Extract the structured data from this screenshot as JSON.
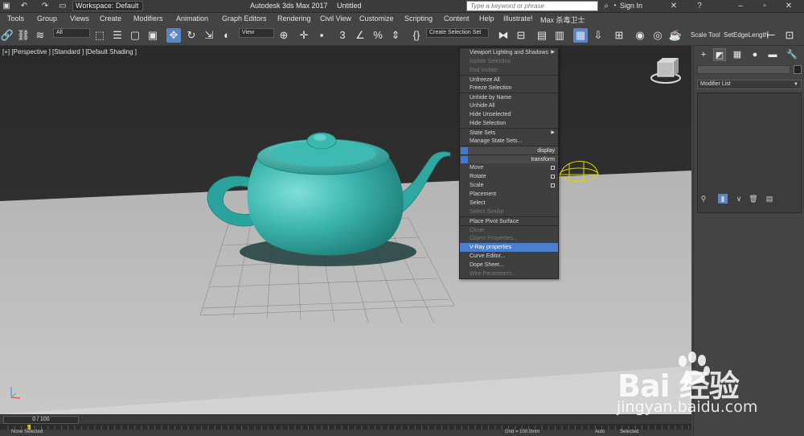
{
  "titlebar": {
    "workspace": "Workspace: Default",
    "app_title": "Autodesk 3ds Max 2017",
    "file_title": "Untitled",
    "search_placeholder": "Type a keyword or phrase",
    "signin": "Sign In"
  },
  "menu": [
    "Tools",
    "Group",
    "Views",
    "Create",
    "Modifiers",
    "Animation",
    "Graph Editors",
    "Rendering",
    "Civil View",
    "Customize",
    "Scripting",
    "Content",
    "Help",
    "Illustrate!",
    "Max 杀毒卫士"
  ],
  "toolbar": {
    "selection_filter": "All",
    "ref_coord": "View",
    "named_selection": "Create Selection Set",
    "scale_tool": "Scale Tool",
    "setedge": "SetEdgeLength"
  },
  "viewport": {
    "label": "[+] [Perspective ] [Standard ] [Default Shading ]",
    "teapot_color": "#3aada6"
  },
  "quad_menu": {
    "items": [
      {
        "label": "Viewport Lighting and Shadows",
        "state": "normal",
        "submenu": true
      },
      {
        "label": "Isolate Selection",
        "state": "disabled"
      },
      {
        "label": "End Isolate",
        "state": "disabled"
      },
      {
        "label": "Unfreeze All",
        "state": "normal",
        "sep": true
      },
      {
        "label": "Freeze Selection",
        "state": "normal"
      },
      {
        "label": "Unhide by Name",
        "state": "normal",
        "sep": true
      },
      {
        "label": "Unhide All",
        "state": "normal"
      },
      {
        "label": "Hide Unselected",
        "state": "normal"
      },
      {
        "label": "Hide Selection",
        "state": "normal"
      },
      {
        "label": "State Sets",
        "state": "normal",
        "sep": true,
        "submenu": true
      },
      {
        "label": "Manage State Sets...",
        "state": "normal"
      },
      {
        "label": "display",
        "state": "header",
        "sep": true
      },
      {
        "label": "transform",
        "state": "header",
        "sep": true
      },
      {
        "label": "Move",
        "state": "normal",
        "box": true
      },
      {
        "label": "Rotate",
        "state": "normal",
        "box": true
      },
      {
        "label": "Scale",
        "state": "normal",
        "box": true
      },
      {
        "label": "Placement",
        "state": "normal"
      },
      {
        "label": "Select",
        "state": "normal"
      },
      {
        "label": "Select Similar",
        "state": "disabled"
      },
      {
        "label": "Place Pivot Surface",
        "state": "normal",
        "sep": true
      },
      {
        "label": "Clone",
        "state": "disabled",
        "sep": true
      },
      {
        "label": "Object Properties...",
        "state": "disabled"
      },
      {
        "label": "V-Ray properties",
        "state": "highlight"
      },
      {
        "label": "Curve Editor...",
        "state": "normal"
      },
      {
        "label": "Dope Sheet...",
        "state": "normal"
      },
      {
        "label": "Wire Parameters...",
        "state": "disabled"
      }
    ]
  },
  "command_panel": {
    "modifier_list": "Modifier List"
  },
  "timeline": {
    "frame": "0 / 100"
  },
  "status": {
    "selection": "None Selected",
    "grid": "Grid = 100.0mm",
    "auto": "Auto",
    "selected": "Selected"
  },
  "watermark": {
    "brand": "Bai 经验",
    "url": "jingyan.baidu.com"
  }
}
